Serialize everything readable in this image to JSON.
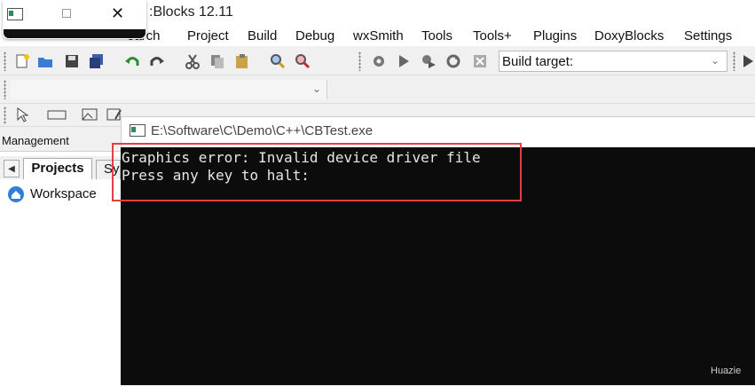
{
  "ide": {
    "title": ":Blocks 12.11",
    "menu": [
      {
        "label": "Search",
        "visible": "earch"
      },
      {
        "label": "Project"
      },
      {
        "label": "Build"
      },
      {
        "label": "Debug"
      },
      {
        "label": "wxSmith"
      },
      {
        "label": "Tools"
      },
      {
        "label": "Tools+"
      },
      {
        "label": "Plugins"
      },
      {
        "label": "DoxyBlocks"
      },
      {
        "label": "Settings"
      }
    ],
    "build_target_label": "Build target:",
    "management": {
      "title": "Management",
      "tabs": {
        "projects": "Projects",
        "symbols": "Sy"
      },
      "workspace_label": "Workspace"
    }
  },
  "console": {
    "title": "E:\\Software\\C\\Demo\\C++\\CBTest.exe",
    "lines": [
      "Graphics error: Invalid device driver file",
      "Press any key to halt:"
    ]
  },
  "watermark": "Huazie",
  "colors": {
    "console_bg": "#0c0c0c",
    "console_text": "#e6e6e6",
    "highlight": "#e04040",
    "window_bg": "#ffffff",
    "ide_bg": "#f0f0f0"
  }
}
